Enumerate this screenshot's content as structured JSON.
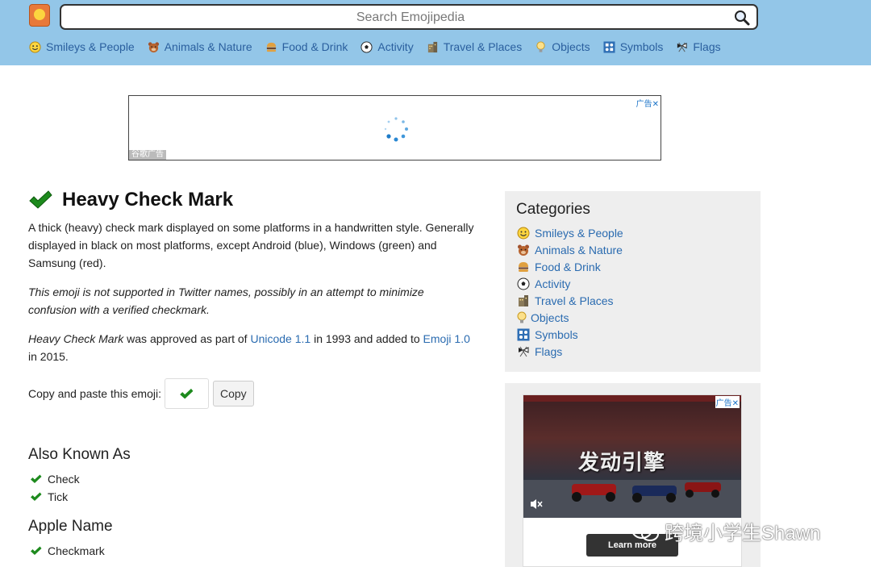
{
  "search": {
    "placeholder": "Search Emojipedia"
  },
  "nav": [
    {
      "label": "Smileys & People",
      "icon": "smiley-icon"
    },
    {
      "label": "Animals & Nature",
      "icon": "bear-icon"
    },
    {
      "label": "Food & Drink",
      "icon": "burger-icon"
    },
    {
      "label": "Activity",
      "icon": "soccer-ball-icon"
    },
    {
      "label": "Travel & Places",
      "icon": "building-icon"
    },
    {
      "label": "Objects",
      "icon": "lightbulb-icon"
    },
    {
      "label": "Symbols",
      "icon": "symbols-icon"
    },
    {
      "label": "Flags",
      "icon": "flag-icon"
    }
  ],
  "ad_top": {
    "close": "广告✕",
    "label": "谷歌广告"
  },
  "emoji": {
    "title": "Heavy Check Mark",
    "description": "A thick (heavy) check mark displayed on some platforms in a handwritten style. Generally displayed in black on most platforms, except Android (blue), Windows (green) and Samsung (red).",
    "note": "This emoji is not supported in Twitter names, possibly in an attempt to minimize confusion with a verified checkmark.",
    "approval": {
      "name": "Heavy Check Mark",
      "text1": " was approved as part of ",
      "unicode_link": "Unicode 1.1",
      "text2": " in 1993 and added to ",
      "emoji_link": "Emoji 1.0",
      "text3": " in 2015."
    },
    "copy_label": "Copy and paste this emoji:",
    "copy_button": "Copy"
  },
  "also_known_as": {
    "heading": "Also Known As",
    "items": [
      "Check",
      "Tick"
    ]
  },
  "apple_name": {
    "heading": "Apple Name",
    "items": [
      "Checkmark"
    ]
  },
  "categories": {
    "heading": "Categories",
    "items": [
      "Smileys & People",
      "Animals & Nature",
      "Food & Drink",
      "Activity",
      "Travel & Places",
      "Objects",
      "Symbols",
      "Flags"
    ]
  },
  "ad_side": {
    "text": "发动引擎",
    "close": "广告✕",
    "cta": "Learn more"
  },
  "watermark": "跨境小学生Shawn",
  "colors": {
    "header": "#93c6e8",
    "link": "#2a6bb0",
    "check": "#1d8a1d"
  }
}
